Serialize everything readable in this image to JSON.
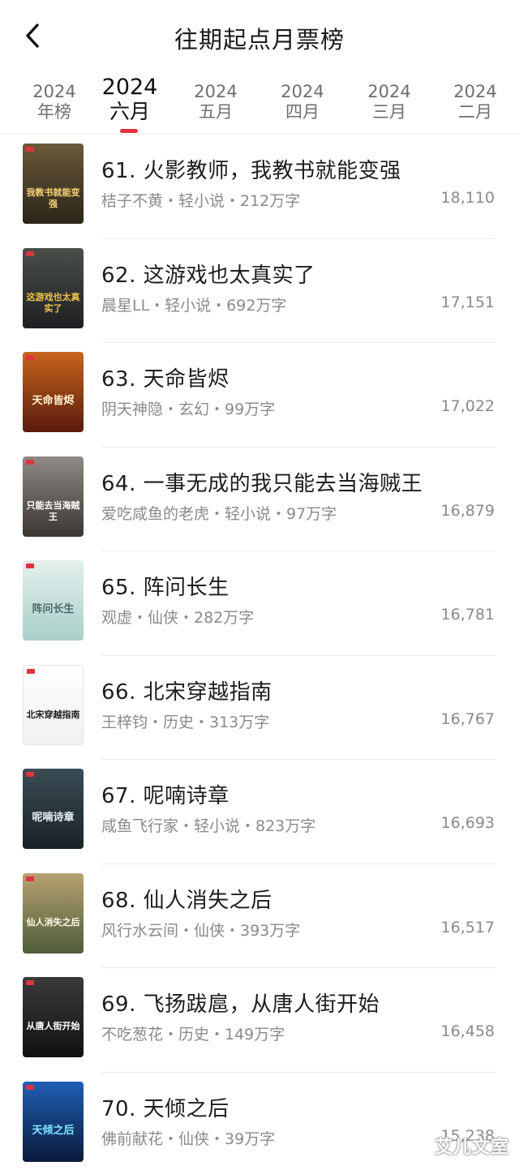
{
  "header": {
    "title": "往期起点月票榜"
  },
  "tabs": [
    {
      "year": "2024",
      "label": "年榜",
      "active": false
    },
    {
      "year": "2024",
      "label": "六月",
      "active": true
    },
    {
      "year": "2024",
      "label": "五月",
      "active": false
    },
    {
      "year": "2024",
      "label": "四月",
      "active": false
    },
    {
      "year": "2024",
      "label": "三月",
      "active": false
    },
    {
      "year": "2024",
      "label": "二月",
      "active": false
    }
  ],
  "books": [
    {
      "title": "61. 火影教师，我教书就能变强",
      "meta": "桔子不黄・轻小说・212万字",
      "votes": "18,110"
    },
    {
      "title": "62. 这游戏也太真实了",
      "meta": "晨星LL・轻小说・692万字",
      "votes": "17,151"
    },
    {
      "title": "63. 天命皆烬",
      "meta": "阴天神隐・玄幻・99万字",
      "votes": "17,022"
    },
    {
      "title": "64. 一事无成的我只能去当海贼王",
      "meta": "爱吃咸鱼的老虎・轻小说・97万字",
      "votes": "16,879"
    },
    {
      "title": "65. 阵问长生",
      "meta": "观虚・仙侠・282万字",
      "votes": "16,781"
    },
    {
      "title": "66. 北宋穿越指南",
      "meta": "王梓钧・历史・313万字",
      "votes": "16,767"
    },
    {
      "title": "67. 呢喃诗章",
      "meta": "咸鱼飞行家・轻小说・823万字",
      "votes": "16,693"
    },
    {
      "title": "68. 仙人消失之后",
      "meta": "风行水云间・仙侠・393万字",
      "votes": "16,517"
    },
    {
      "title": "69. 飞扬跋扈，从唐人街开始",
      "meta": "不吃葱花・历史・149万字",
      "votes": "16,458"
    },
    {
      "title": "70. 天倾之后",
      "meta": "佛前献花・仙侠・39万字",
      "votes": "15,238"
    }
  ],
  "covers": [
    {
      "text": "我教书就能变强",
      "bg": "#6b5a3a",
      "bg2": "#2c2418",
      "fg": "#f5d27a"
    },
    {
      "text": "这游戏也太真实了",
      "bg": "#4a4f4a",
      "bg2": "#1e1f22",
      "fg": "#f3c64a"
    },
    {
      "text": "天命皆烬",
      "bg": "#c9651e",
      "bg2": "#5a1a0c",
      "fg": "#fff2d0"
    },
    {
      "text": "只能去当海贼王",
      "bg": "#8f8a85",
      "bg2": "#3a3633",
      "fg": "#ffffff"
    },
    {
      "text": "阵问长生",
      "bg": "#e4f0ee",
      "bg2": "#a9cfc8",
      "fg": "#4b6a6a"
    },
    {
      "text": "北宋穿越指南",
      "bg": "#ffffff",
      "bg2": "#f0f0f0",
      "fg": "#222222"
    },
    {
      "text": "呢喃诗章",
      "bg": "#3b4c55",
      "bg2": "#1a2228",
      "fg": "#e8edf0"
    },
    {
      "text": "仙人消失之后",
      "bg": "#b7a270",
      "bg2": "#4e5c3a",
      "fg": "#fffbe9"
    },
    {
      "text": "从唐人街开始",
      "bg": "#3a3a3a",
      "bg2": "#111111",
      "fg": "#ffffff"
    },
    {
      "text": "天倾之后",
      "bg": "#1f5fb5",
      "bg2": "#0a1a3a",
      "fg": "#7fe4ff"
    }
  ],
  "watermark": "艾儿文室"
}
